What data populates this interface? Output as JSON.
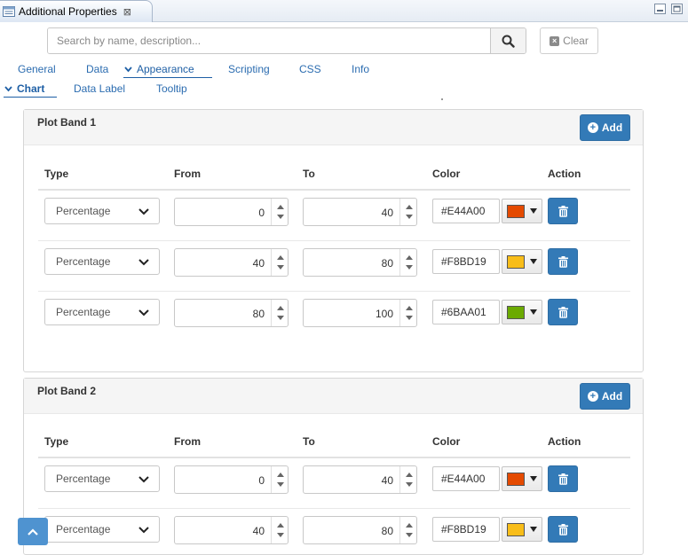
{
  "window": {
    "title": "Additional Properties",
    "close_symbol": "⊠"
  },
  "search": {
    "placeholder": "Search by name, description...",
    "value": ""
  },
  "clear_label": "Clear",
  "primary_tabs": [
    "General",
    "Data",
    "Appearance",
    "Scripting",
    "CSS",
    "Info"
  ],
  "primary_active": "Appearance",
  "secondary_tabs": [
    "Chart",
    "Data Label",
    "Tooltip"
  ],
  "secondary_active": "Chart",
  "columns": {
    "type": "Type",
    "from": "From",
    "to": "To",
    "color": "Color",
    "action": "Action"
  },
  "add_label": "Add",
  "plot_bands": [
    {
      "title": "Plot Band 1",
      "rows": [
        {
          "type": "Percentage",
          "from": "0",
          "to": "40",
          "color": "#E44A00"
        },
        {
          "type": "Percentage",
          "from": "40",
          "to": "80",
          "color": "#F8BD19"
        },
        {
          "type": "Percentage",
          "from": "80",
          "to": "100",
          "color": "#6BAA01"
        }
      ]
    },
    {
      "title": "Plot Band 2",
      "rows": [
        {
          "type": "Percentage",
          "from": "0",
          "to": "40",
          "color": "#E44A00"
        },
        {
          "type": "Percentage",
          "from": "40",
          "to": "80",
          "color": "#F8BD19"
        }
      ]
    }
  ],
  "accent_color": "#337ab7"
}
